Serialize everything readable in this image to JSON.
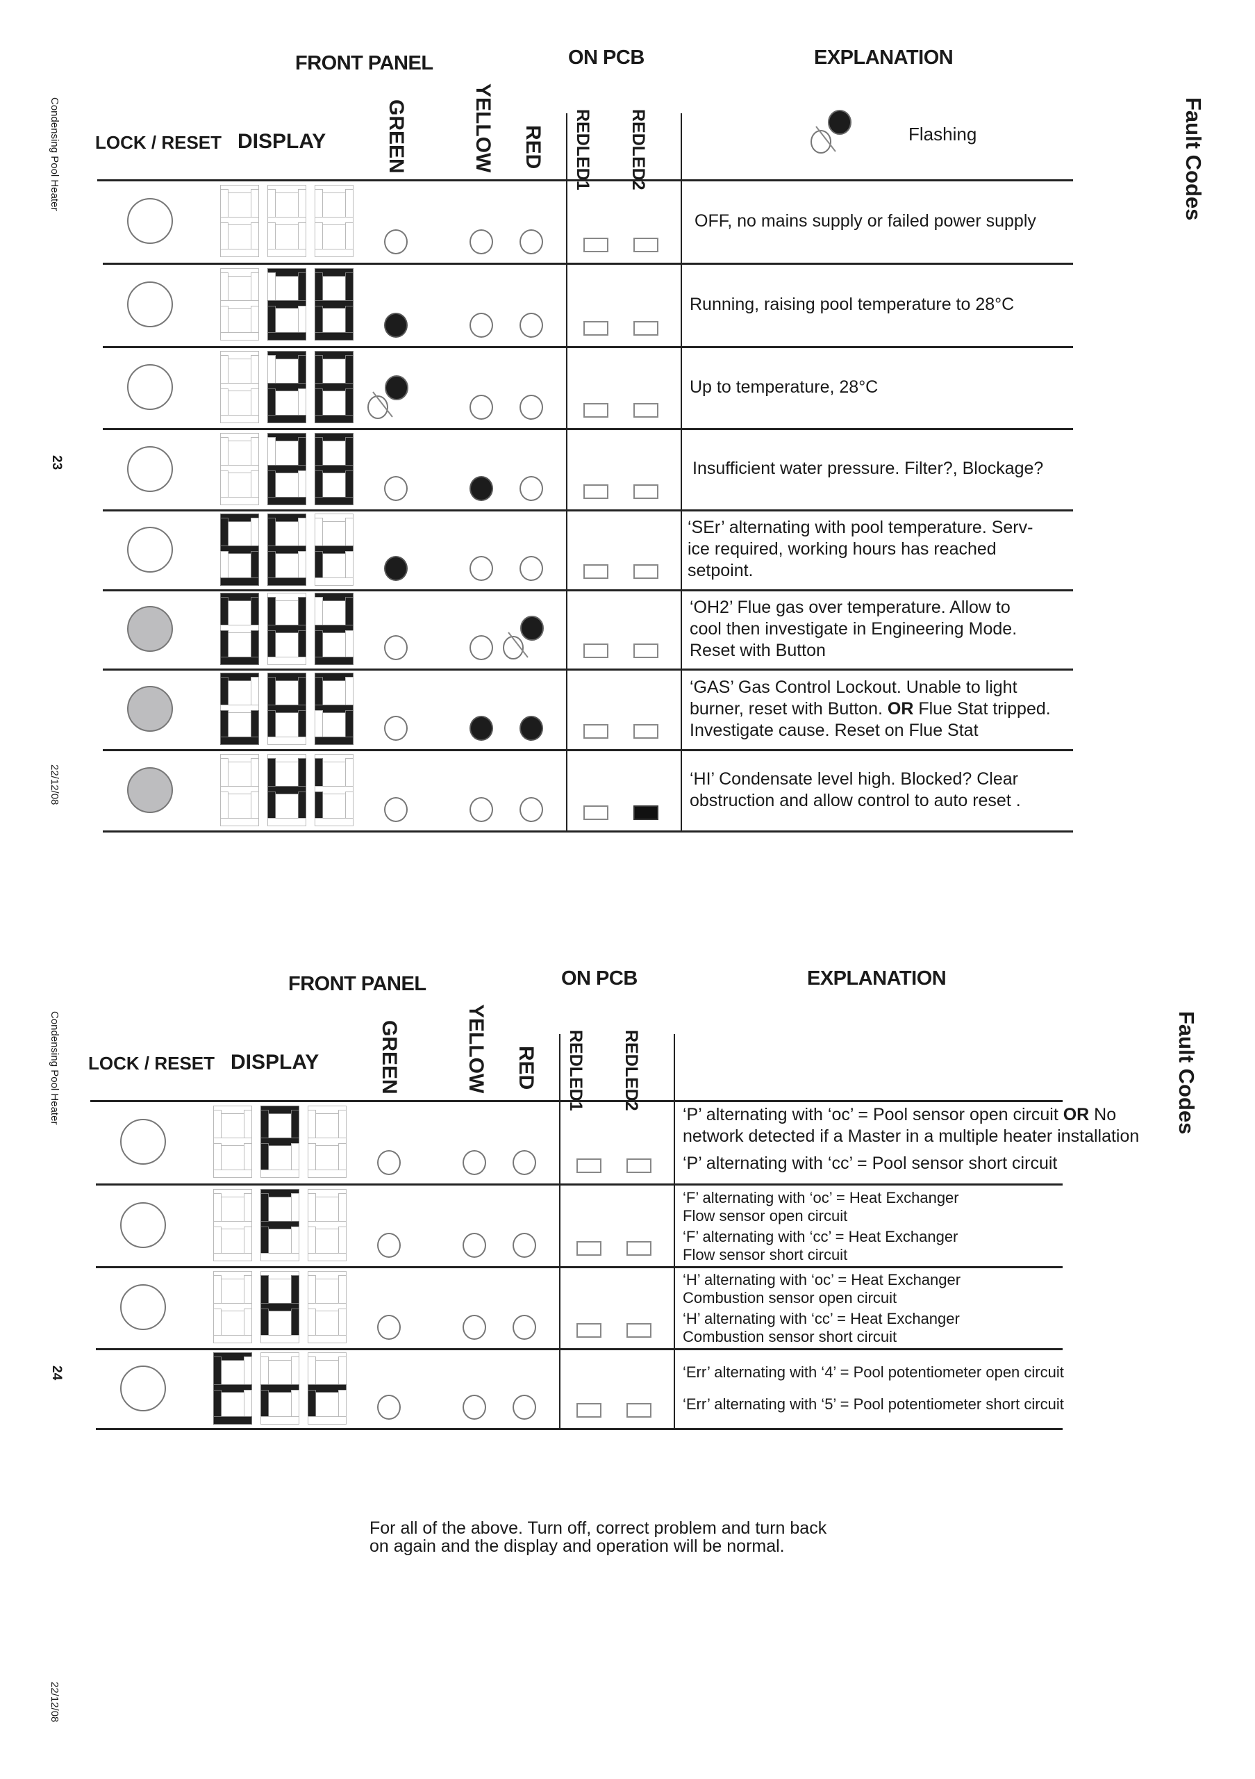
{
  "document": {
    "product": "Condensing Pool Heater",
    "section_title": "Fault Codes",
    "date": "22/12/08"
  },
  "colors": {
    "led_on": "#1c1c1c",
    "lock_lit": "#bdbdbf",
    "segment_off": "#bbbbbb",
    "segment_on": "#1e1e1e"
  },
  "headers": {
    "front_panel": "FRONT PANEL",
    "on_pcb": "ON PCB",
    "explanation": "EXPLANATION",
    "lock_reset": "LOCK / RESET",
    "display": "DISPLAY",
    "green": "GREEN",
    "yellow": "YELLOW",
    "red": "RED",
    "red_led1_a": "RED",
    "red_led1_b": "LED1",
    "red_led2_a": "RED",
    "red_led2_b": "LED2"
  },
  "legend": {
    "icon": "flashing-led-icon",
    "label": "Flashing"
  },
  "pages": [
    {
      "page_number": "23",
      "rows": [
        {
          "lock": "off",
          "display": "   ",
          "green": "off",
          "yellow": "off",
          "red": "off",
          "led1": "off",
          "led2": "off",
          "explanation": [
            "OFF, no mains supply or failed power supply"
          ]
        },
        {
          "lock": "off",
          "display": " 28",
          "green": "on",
          "yellow": "off",
          "red": "off",
          "led1": "off",
          "led2": "off",
          "explanation": [
            "Running, raising pool temperature to 28°C"
          ]
        },
        {
          "lock": "off",
          "display": " 28",
          "green": "flashing",
          "yellow": "off",
          "red": "off",
          "led1": "off",
          "led2": "off",
          "explanation": [
            "Up to temperature, 28°C"
          ]
        },
        {
          "lock": "off",
          "display": " 28",
          "green": "off",
          "yellow": "on",
          "red": "off",
          "led1": "off",
          "led2": "off",
          "explanation": [
            "Insufficient water pressure. Filter?, Blockage?"
          ]
        },
        {
          "lock": "off",
          "display": "SEr",
          "green": "on",
          "yellow": "off",
          "red": "off",
          "led1": "off",
          "led2": "off",
          "explanation": [
            "‘SEr’ alternating with pool temperature. Serv-",
            "ice required, working hours has reached",
            "setpoint."
          ]
        },
        {
          "lock": "lit",
          "display": "OH2",
          "green": "off",
          "yellow": "off",
          "red": "flashing",
          "led1": "off",
          "led2": "off",
          "explanation": [
            "‘OH2’ Flue gas over temperature. Allow to",
            "cool then investigate in Engineering Mode.",
            "Reset with Button"
          ]
        },
        {
          "lock": "lit",
          "display": "GAS",
          "green": "off",
          "yellow": "on",
          "red": "on",
          "led1": "off",
          "led2": "off",
          "explanation": [
            "‘GAS’ Gas Control Lockout. Unable to light",
            "burner, reset with Button. **OR** Flue Stat tripped.",
            "Investigate cause. Reset on Flue Stat"
          ]
        },
        {
          "lock": "lit",
          "display": " HI",
          "green": "off",
          "yellow": "off",
          "red": "off",
          "led1": "off",
          "led2": "on",
          "explanation": [
            "‘HI’ Condensate level high. Blocked? Clear",
            "obstruction and allow control to auto reset ."
          ]
        }
      ]
    },
    {
      "page_number": "24",
      "rows": [
        {
          "lock": "off",
          "display": " P ",
          "green": "off",
          "yellow": "off",
          "red": "off",
          "led1": "off",
          "led2": "off",
          "explanation": [
            "‘P’ alternating with ‘oc’ = Pool sensor open circuit **OR** No",
            "network detected if a Master in a multiple heater installation",
            "‘P’ alternating with ‘cc’ = Pool sensor short circuit"
          ]
        },
        {
          "lock": "off",
          "display": " F ",
          "green": "off",
          "yellow": "off",
          "red": "off",
          "led1": "off",
          "led2": "off",
          "explanation": [
            "‘F’ alternating with ‘oc’ = Heat Exchanger",
            "Flow sensor open circuit",
            "‘F’ alternating with ‘cc’ = Heat Exchanger",
            "Flow sensor short circuit"
          ]
        },
        {
          "lock": "off",
          "display": " H ",
          "green": "off",
          "yellow": "off",
          "red": "off",
          "led1": "off",
          "led2": "off",
          "explanation": [
            "‘H’ alternating with ‘oc’ = Heat Exchanger",
            "Combustion sensor open circuit",
            "‘H’ alternating with ‘cc’ = Heat Exchanger",
            "Combustion sensor short circuit"
          ]
        },
        {
          "lock": "off",
          "display": "Err",
          "green": "off",
          "yellow": "off",
          "red": "off",
          "led1": "off",
          "led2": "off",
          "explanation": [
            "‘Err’ alternating with ‘4’ = Pool potentiometer open circuit",
            "‘Err’ alternating with ‘5’ = Pool potentiometer short circuit"
          ]
        }
      ],
      "footer": [
        "For all of the above. Turn off, correct problem and turn back",
        "on again and the display and operation will be normal."
      ]
    }
  ]
}
